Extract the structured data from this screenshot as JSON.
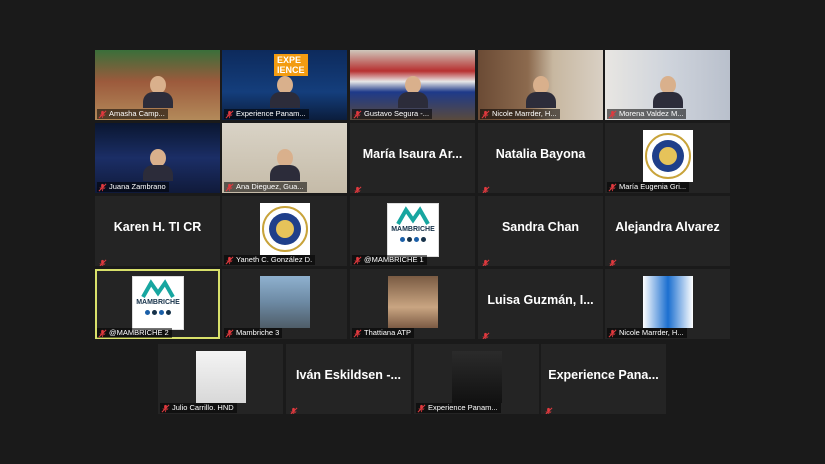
{
  "meeting": {
    "tiles": [
      {
        "id": "t1",
        "label": "Amasha Camp...",
        "type": "video"
      },
      {
        "id": "t2",
        "label": "Experience Panam...",
        "type": "video",
        "banner": "EXPE\nIENCE"
      },
      {
        "id": "t3",
        "label": "Gustavo Segura -...",
        "type": "video"
      },
      {
        "id": "t4",
        "label": "Nicole Marrder, H...",
        "type": "video"
      },
      {
        "id": "t5",
        "label": "Morena Valdez M...",
        "type": "video"
      },
      {
        "id": "t6",
        "label": "Juana Zambrano",
        "type": "video"
      },
      {
        "id": "t7",
        "label": "Ana Dieguez, Gua...",
        "type": "video"
      },
      {
        "id": "t8",
        "name": "María Isaura Ar...",
        "type": "name"
      },
      {
        "id": "t9",
        "name": "Natalia Bayona",
        "type": "name"
      },
      {
        "id": "t10",
        "label": "María Eugenia Gri...",
        "type": "seal"
      },
      {
        "id": "t11",
        "name": "Karen H. TI CR",
        "type": "name"
      },
      {
        "id": "t12",
        "label": "Yaneth C. González D.",
        "type": "seal"
      },
      {
        "id": "t13",
        "label": "@MAMBRICHE 1",
        "type": "logo",
        "logo_text": "MAMBRICHE"
      },
      {
        "id": "t14",
        "name": "Sandra Chan",
        "type": "name"
      },
      {
        "id": "t15",
        "name": "Alejandra Alvarez",
        "type": "name"
      },
      {
        "id": "t16",
        "label": "@MAMBRICHE 2",
        "type": "logo",
        "logo_text": "MAMBRICHE",
        "active": true
      },
      {
        "id": "t17",
        "label": "Mambriche 3",
        "type": "photo"
      },
      {
        "id": "t18",
        "label": "Thattiana ATP",
        "type": "photo"
      },
      {
        "id": "t19",
        "name": "Luisa Guzmán, I...",
        "type": "name"
      },
      {
        "id": "t20",
        "label": "Nicole Marrder, H...",
        "type": "photo"
      },
      {
        "id": "t21",
        "label": "Julio Carrillo. HND",
        "type": "photo"
      },
      {
        "id": "t22",
        "name": "Iván Eskildsen -...",
        "type": "name"
      },
      {
        "id": "t23",
        "label": "Experience Panam...",
        "type": "photo"
      },
      {
        "id": "t24",
        "name": "Experience Pana...",
        "type": "name"
      }
    ]
  },
  "colors": {
    "background": "#1a1a1a",
    "tile": "#242424",
    "active_border": "#d8e06a",
    "muted_mic": "#e0393e"
  },
  "icons": {
    "muted": "mic-muted-icon"
  }
}
